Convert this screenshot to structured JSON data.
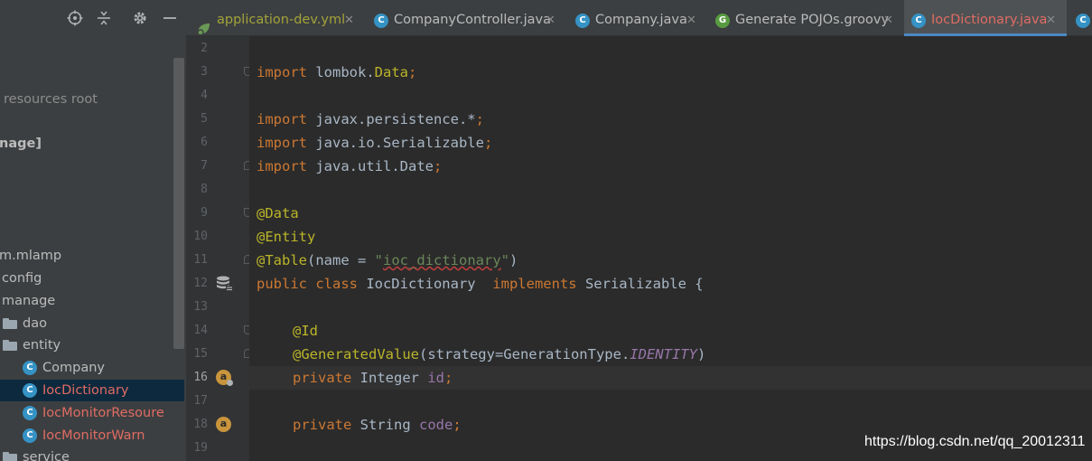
{
  "project_panel": {
    "items": [
      {
        "label": "resources root",
        "kind": "text"
      },
      {
        "label": "nage]",
        "kind": "text"
      },
      {
        "label": "m.mlamp",
        "kind": "text"
      },
      {
        "label": "config",
        "kind": "text"
      },
      {
        "label": "manage",
        "kind": "text"
      },
      {
        "label": "dao",
        "kind": "folder"
      },
      {
        "label": "entity",
        "kind": "folder"
      },
      {
        "label": "Company",
        "kind": "class",
        "icon_letter": "C"
      },
      {
        "label": "IocDictionary",
        "kind": "class",
        "icon_letter": "C",
        "selected": true
      },
      {
        "label": "IocMonitorResoure",
        "kind": "class",
        "icon_letter": "C"
      },
      {
        "label": "IocMonitorWarn",
        "kind": "class",
        "icon_letter": "C"
      },
      {
        "label": "service",
        "kind": "folder"
      }
    ]
  },
  "tabs": [
    {
      "label": "application-dev.yml",
      "icon": "spring-leaf-icon"
    },
    {
      "label": "CompanyController.java",
      "icon_letter": "C"
    },
    {
      "label": "Company.java",
      "icon_letter": "C"
    },
    {
      "label": "Generate POJOs.groovy",
      "icon_letter": "G"
    },
    {
      "label": "IocDictionary.java",
      "icon_letter": "C",
      "active": true
    }
  ],
  "tab_close_glyph": "✕",
  "gutter": {
    "line_numbers": [
      "2",
      "3",
      "4",
      "5",
      "6",
      "7",
      "8",
      "9",
      "10",
      "11",
      "12",
      "13",
      "14",
      "15",
      "16",
      "17",
      "18",
      "19"
    ],
    "current_line": "16",
    "badge_letter": "a"
  },
  "code": {
    "l3_kw": "import",
    "l3_pkg": " lombok.",
    "l3_cls": "Data",
    "l3_end": ";",
    "l5_kw": "import",
    "l5_rest": " javax.persistence.*",
    "l5_end": ";",
    "l6_kw": "import",
    "l6_rest": " java.io.Serializable",
    "l6_end": ";",
    "l7_kw": "import",
    "l7_rest": " java.util.Date",
    "l7_end": ";",
    "l9": "@Data",
    "l10": "@Entity",
    "l11_an": "@Table",
    "l11_open": "(name = ",
    "l11_q1": "\"",
    "l11_str": "ioc_dictionary",
    "l11_q2": "\"",
    "l11_close": ")",
    "l12_kw1": "public class",
    "l12_name": " IocDictionary  ",
    "l12_kw2": "implements",
    "l12_rest": " Serializable {",
    "l14": "@Id",
    "l15_an": "@GeneratedValue",
    "l15_mid": "(strategy=GenerationType.",
    "l15_const": "IDENTITY",
    "l15_end": ")",
    "l16_kw": "private",
    "l16_type": " Integer ",
    "l16_field": "id",
    "l16_end": ";",
    "l18_kw": "private",
    "l18_type": " String ",
    "l18_field": "code",
    "l18_end": ";"
  },
  "watermark": "https://blog.csdn.net/qq_20012311",
  "colors": {
    "keyword": "#cc7832",
    "annotation": "#bbb529",
    "string": "#6a8759",
    "field": "#9876aa",
    "error_text": "#e06c63"
  }
}
